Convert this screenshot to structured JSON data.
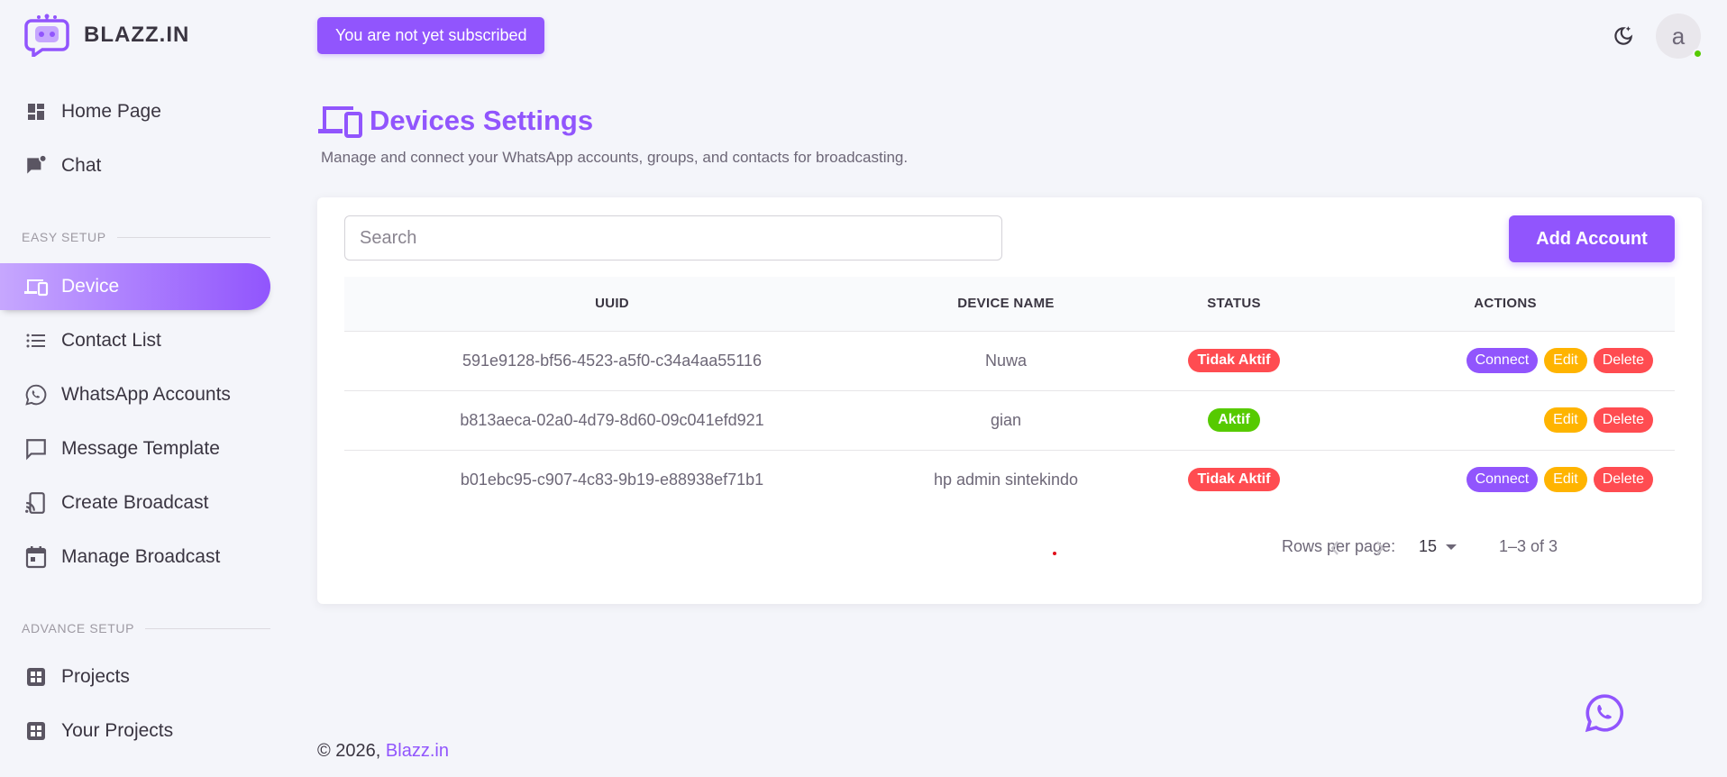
{
  "brand": {
    "name": "BLAZZ.IN"
  },
  "header": {
    "subscription_notice": "You are not yet subscribed",
    "avatar_initial": "a"
  },
  "sidebar": {
    "top_items": [
      {
        "label": "Home Page",
        "icon": "dashboard-icon"
      },
      {
        "label": "Chat",
        "icon": "chat-icon"
      }
    ],
    "easy_setup_label": "EASY SETUP",
    "easy_setup_items": [
      {
        "label": "Device",
        "icon": "devices-icon",
        "active": true
      },
      {
        "label": "Contact List",
        "icon": "list-icon"
      },
      {
        "label": "WhatsApp Accounts",
        "icon": "whatsapp-icon"
      },
      {
        "label": "Message Template",
        "icon": "message-icon"
      },
      {
        "label": "Create Broadcast",
        "icon": "cast-icon"
      },
      {
        "label": "Manage Broadcast",
        "icon": "calendar-icon"
      }
    ],
    "advance_setup_label": "ADVANCE SETUP",
    "advance_setup_items": [
      {
        "label": "Projects",
        "icon": "apps-icon"
      },
      {
        "label": "Your Projects",
        "icon": "apps-icon"
      }
    ]
  },
  "page": {
    "title": "Devices Settings",
    "subtitle": "Manage and connect your WhatsApp accounts, groups, and contacts for broadcasting."
  },
  "toolbar": {
    "search_placeholder": "Search",
    "add_label": "Add Account"
  },
  "table": {
    "headers": [
      "UUID",
      "DEVICE NAME",
      "STATUS",
      "ACTIONS"
    ],
    "rows": [
      {
        "uuid": "591e9128-bf56-4523-a5f0-c34a4aa55116",
        "name": "Nuwa",
        "status": "Tidak Aktif",
        "connect": "Connect",
        "edit": "Edit",
        "delete": "Delete"
      },
      {
        "uuid": "b813aeca-02a0-4d79-8d60-09c041efd921",
        "name": "gian",
        "status": "Aktif",
        "edit": "Edit",
        "delete": "Delete"
      },
      {
        "uuid": "b01ebc95-c907-4c83-9b19-e88938ef71b1",
        "name": "hp admin sintekindo",
        "status": "Tidak Aktif",
        "connect": "Connect",
        "edit": "Edit",
        "delete": "Delete"
      }
    ]
  },
  "pagination": {
    "rows_per_page_label": "Rows per page:",
    "rows_per_page": "15",
    "range": "1–3 of 3"
  },
  "footer": {
    "copyright": "© 2026,",
    "link": "Blazz.in"
  },
  "colors": {
    "primary": "#9155fd",
    "success": "#56ca00",
    "warning": "#ffb400",
    "error": "#ff4c51"
  }
}
